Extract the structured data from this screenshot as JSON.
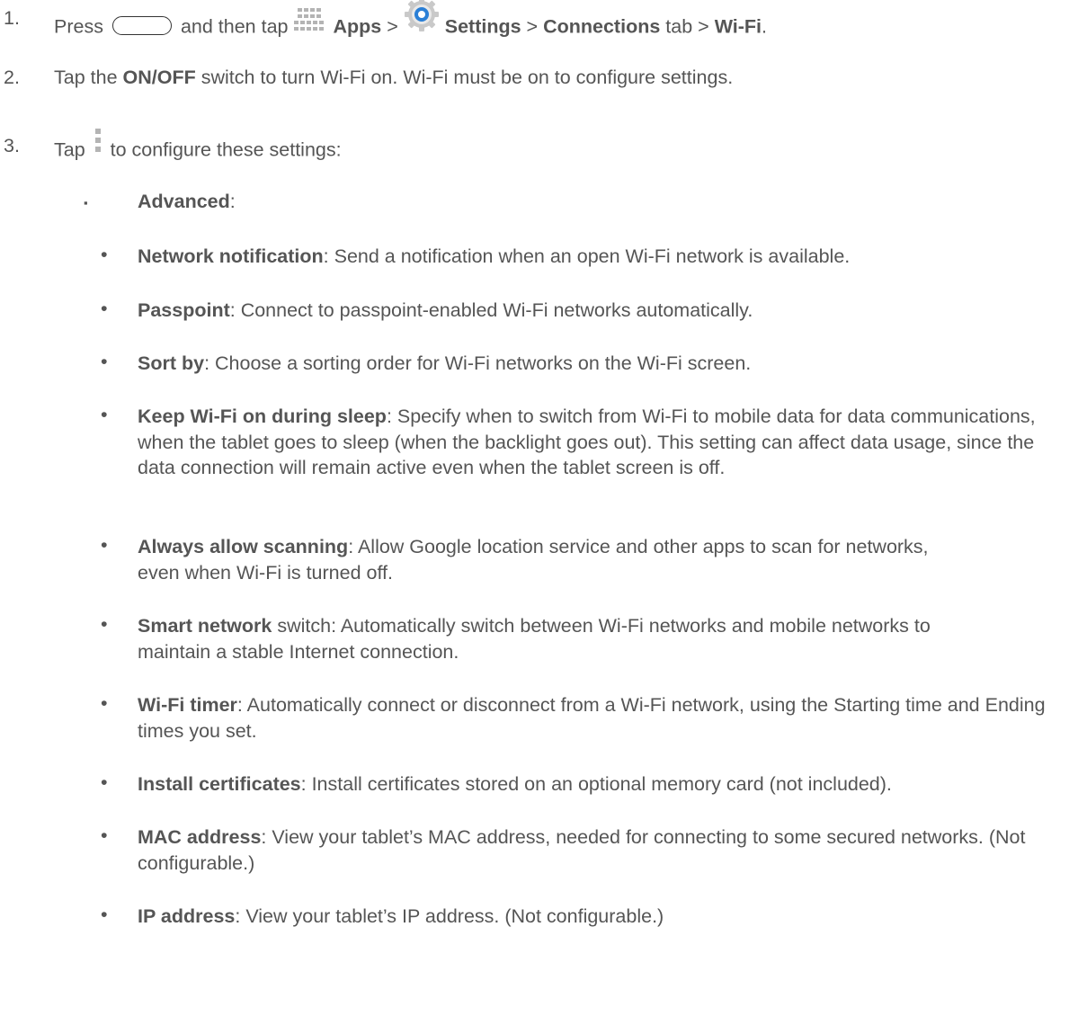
{
  "steps": [
    {
      "num": "1.",
      "press": "Press",
      "and_then_tap": "and then tap",
      "apps": "Apps",
      "sep1": ">",
      "settings": "Settings",
      "sep2": ">",
      "connections": "Connections",
      "tab_sep": "tab >",
      "wifi": "Wi-Fi",
      "end": "."
    },
    {
      "num": "2.",
      "tap": "Tap the",
      "onoff": "ON/OFF",
      "rest": "switch to turn Wi-Fi on. Wi-Fi must be on to configure settings."
    },
    {
      "num": "3.",
      "tap": "Tap",
      "rest": "to configure these settings:"
    }
  ],
  "advanced": {
    "marker": "▪",
    "label": "Advanced",
    "colon": ":"
  },
  "items": [
    {
      "term": "Network notification",
      "desc": ": Send a notification when an open Wi-Fi network is available."
    },
    {
      "term": "Passpoint",
      "desc": ": Connect to passpoint-enabled Wi-Fi networks automatically."
    },
    {
      "term": "Sort by",
      "desc": ": Choose a sorting order for Wi-Fi networks on the Wi-Fi screen."
    },
    {
      "term": "Keep Wi-Fi on during sleep",
      "desc": ": Specify when to switch from Wi-Fi to mobile data for data communications, when the tablet goes to sleep (when the backlight goes out). This setting can affect data usage, since the data connection will remain active even when the tablet screen is off."
    },
    {
      "term": "Always allow scanning",
      "desc": ": Allow Google location service and other apps to scan for networks, even when Wi-Fi is turned off."
    },
    {
      "term": "Smart network",
      "desc": " switch: Automatically switch between Wi-Fi networks and mobile networks to maintain a stable Internet connection."
    },
    {
      "term": "Wi-Fi timer",
      "desc": ": Automatically connect or disconnect from a Wi-Fi network, using the Starting time and Ending times you set."
    },
    {
      "term": "Install certificates",
      "desc": ": Install certificates stored on an optional memory card (not included)."
    },
    {
      "term": "MAC address",
      "desc": ": View your tablet’s MAC address, needed for connecting to some secured networks. (Not configurable.)"
    },
    {
      "term": "IP address",
      "desc": ": View your tablet’s IP address. (Not configurable.)"
    }
  ],
  "bullet": "•",
  "icons": {
    "home": "home-button-icon",
    "apps": "apps-grid-icon",
    "settings": "settings-gear-icon",
    "menu": "more-options-icon"
  },
  "colors": {
    "text": "#555555",
    "settings_icon_blue": "#2a7fd6"
  }
}
